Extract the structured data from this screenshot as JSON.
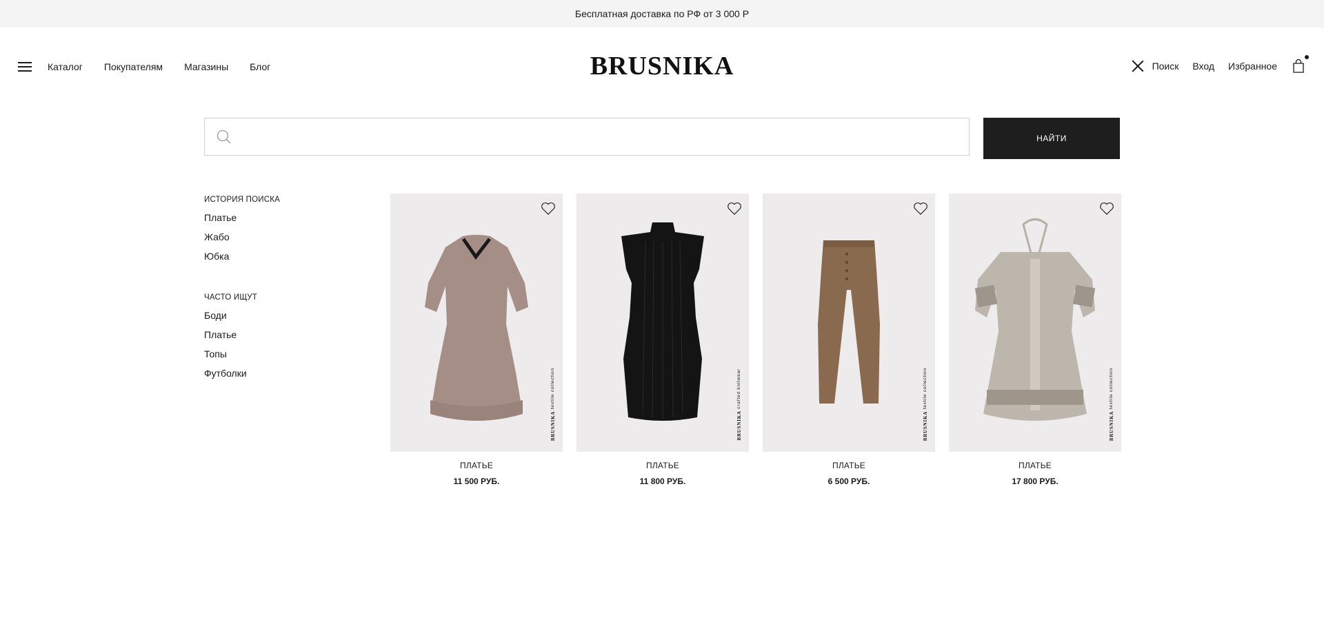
{
  "promo_bar": {
    "text": "Бесплатная доставка по РФ от 3 000 Р"
  },
  "header": {
    "logo": "BRUSNIKA",
    "nav": [
      "Каталог",
      "Покупателям",
      "Магазины",
      "Блог"
    ],
    "right": {
      "search": "Поиск",
      "login": "Вход",
      "favorites": "Избранное"
    },
    "cart_has_items": true
  },
  "search": {
    "value": "",
    "placeholder": "",
    "button": "НАЙТИ"
  },
  "sidebar": {
    "history": {
      "title": "ИСТОРИЯ ПОИСКА",
      "items": [
        "Платье",
        "Жабо",
        "Юбка"
      ]
    },
    "popular": {
      "title": "ЧАСТО ИЩУТ",
      "items": [
        "Боди",
        "Платье",
        "Топы",
        "Футболки"
      ]
    }
  },
  "products": [
    {
      "name": "ПЛАТЬЕ",
      "price": "11 500 РУБ.",
      "image": "beige-dress-icon",
      "color": "#a58e86",
      "watermark_brand": "BRUSNIKA",
      "watermark_text": "textile collection"
    },
    {
      "name": "ПЛАТЬЕ",
      "price": "11 800 РУБ.",
      "image": "black-knit-dress-icon",
      "color": "#141414",
      "watermark_brand": "BRUSNIKA",
      "watermark_text": "crafted knitwear"
    },
    {
      "name": "ПЛАТЬЕ",
      "price": "6 500 РУБ.",
      "image": "brown-trousers-icon",
      "color": "#8a6a4f",
      "watermark_brand": "BRUSNIKA",
      "watermark_text": "textile collection"
    },
    {
      "name": "ПЛАТЬЕ",
      "price": "17 800 РУБ.",
      "image": "linen-embroidered-dress-icon",
      "color": "#b7b0a6",
      "watermark_brand": "BRUSNIKA",
      "watermark_text": "textile collection"
    }
  ]
}
